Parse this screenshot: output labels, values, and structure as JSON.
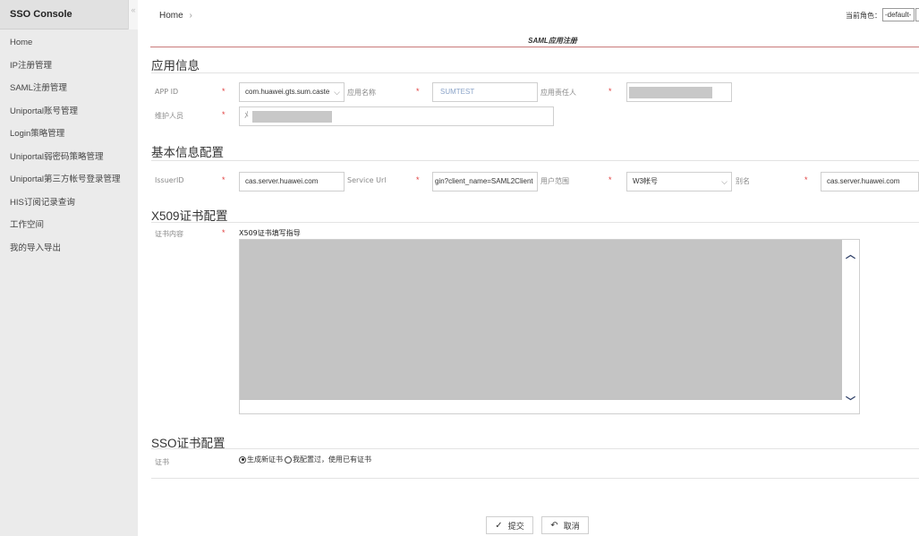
{
  "sidebar": {
    "title": "SSO Console",
    "collapse_icon": "«",
    "items": [
      {
        "label": "Home"
      },
      {
        "label": "IP注册管理"
      },
      {
        "label": "SAML注册管理"
      },
      {
        "label": "Uniportal账号管理"
      },
      {
        "label": "Login策略管理"
      },
      {
        "label": "Uniportal弱密码策略管理"
      },
      {
        "label": "Uniportal第三方帐号登录管理"
      },
      {
        "label": "HIS订阅记录查询"
      },
      {
        "label": "工作空间"
      },
      {
        "label": "我的导入导出"
      }
    ]
  },
  "header": {
    "breadcrumb": "Home",
    "breadcrumb_sep": "›",
    "role_label": "当前角色：",
    "role_value": "-default-"
  },
  "page": {
    "title": "SAML应用注册"
  },
  "app_info": {
    "title": "应用信息",
    "app_id_label": "APP ID",
    "app_id_value": "com.huawei.gts.sum.caste",
    "app_name_label": "应用名称",
    "app_name_placeholder": "SUMTEST",
    "owner_label": "应用责任人",
    "maintainer_label": "维护人员"
  },
  "basic_config": {
    "title": "基本信息配置",
    "issuer_label": "IssuerID",
    "issuer_value": "cas.server.huawei.com",
    "service_url_label": "Service Url",
    "service_url_value": "gin?client_name=SAML2Client",
    "user_scope_label": "用户范围",
    "user_scope_value": "W3帐号",
    "alias_label": "别名",
    "alias_value": "cas.server.huawei.com"
  },
  "x509": {
    "title": "X509证书配置",
    "content_label": "证书内容",
    "guide_label": "X509证书填写指导"
  },
  "sso_cert": {
    "title": "SSO证书配置",
    "cert_label": "证书",
    "option_new": "生成新证书",
    "option_existing": "我配置过，使用已有证书",
    "selected": "new"
  },
  "actions": {
    "submit_label": "提交",
    "cancel_label": "取消"
  },
  "required_mark": "*",
  "colors": {
    "required": "#e03c3c",
    "sidebar_bg": "#ebebeb",
    "title_underline": "#c97a7a"
  }
}
